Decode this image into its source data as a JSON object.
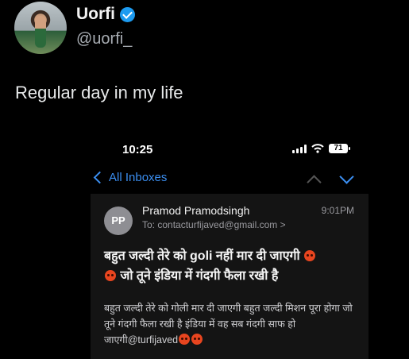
{
  "tweet": {
    "display_name": "Uorfi",
    "handle": "@uorfi_",
    "text": "Regular day in my life",
    "verified": true
  },
  "screenshot": {
    "status_bar": {
      "time": "10:25",
      "battery": "71"
    },
    "nav": {
      "back_label": "All Inboxes"
    },
    "email": {
      "avatar_initials": "PP",
      "sender": "Pramod Pramodsingh",
      "recipient": "To: contacturfijaved@gmail.com >",
      "time": "9:01PM",
      "subject_line1": "बहुत जल्दी तेरे को goli नहीं मार दी जाएगी",
      "subject_line2": "जो तूने इंडिया में गंदगी फैला रखी है",
      "body": "बहुत जल्दी तेरे को गोली मार दी जाएगी बहुत जल्दी मिशन पूरा होगा जो तूने गंदगी फैला रखी है इंडिया में वह सब गंदगी साफ हो जाएगी@turfijaved"
    }
  },
  "colors": {
    "accent": "#3b8ef0",
    "verified": "#1d9bf0",
    "angry_emoji": "#e8451f"
  }
}
